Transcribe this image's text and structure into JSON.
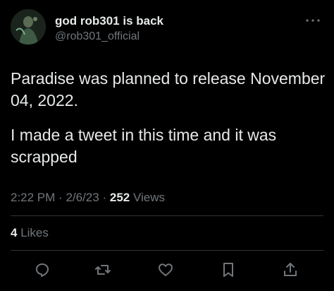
{
  "author": {
    "display_name": "god rob301 is back",
    "handle": "@rob301_official"
  },
  "more_icon": "more-horizontal-icon",
  "tweet": {
    "paragraphs": [
      "Paradise was planned to release November 04, 2022.",
      "I made a tweet in this time and it was scrapped"
    ],
    "time": "2:22 PM",
    "date": "2/6/23",
    "separator": "·",
    "views_count": "252",
    "views_label": "Views"
  },
  "engagement": {
    "likes_count": "4",
    "likes_label": "Likes"
  },
  "actions": [
    {
      "name": "reply",
      "icon": "reply-icon"
    },
    {
      "name": "retweet",
      "icon": "retweet-icon"
    },
    {
      "name": "like",
      "icon": "heart-icon"
    },
    {
      "name": "bookmark",
      "icon": "bookmark-icon"
    },
    {
      "name": "share",
      "icon": "share-icon"
    }
  ],
  "colors": {
    "background": "#000000",
    "primary_text": "#e7e9ea",
    "secondary_text": "#71767b",
    "divider": "#2f3336"
  }
}
